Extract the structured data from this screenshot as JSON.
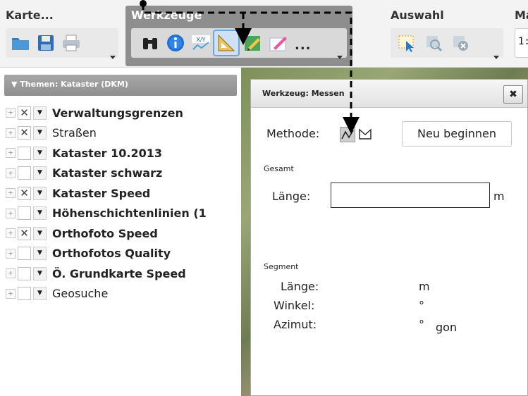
{
  "toolbar": {
    "groups": {
      "karte": {
        "title": "Karte..."
      },
      "werkzeuge": {
        "title": "Werkzeuge"
      },
      "auswahl": {
        "title": "Auswahl"
      },
      "massstab": {
        "title": "Ma",
        "scale_value": "1:"
      }
    },
    "more_label": "..."
  },
  "themes": {
    "header": "Themen: Kataster (DKM)",
    "layers": [
      {
        "label": "Verwaltungsgrenzen",
        "checked": true,
        "bold": true
      },
      {
        "label": "Straßen",
        "checked": true,
        "bold": false
      },
      {
        "label": "Kataster 10.2013",
        "checked": false,
        "bold": true
      },
      {
        "label": "Kataster schwarz",
        "checked": false,
        "bold": true
      },
      {
        "label": "Kataster Speed",
        "checked": true,
        "bold": true
      },
      {
        "label": "Höhenschichtenlinien (1",
        "checked": false,
        "bold": true
      },
      {
        "label": "Orthofoto Speed",
        "checked": true,
        "bold": true
      },
      {
        "label": "Orthofotos Quality",
        "checked": false,
        "bold": true
      },
      {
        "label": "Ö. Grundkarte Speed",
        "checked": false,
        "bold": true
      },
      {
        "label": "Geosuche",
        "checked": false,
        "bold": false
      }
    ],
    "expander_symbol": "+",
    "checked_symbol": "✕",
    "menu_symbol": "▼"
  },
  "dialog": {
    "title": "Werkzeug: Messen",
    "close_symbol": "✖",
    "method_label": "Methode:",
    "new_button": "Neu beginnen",
    "total_section": "Gesamt",
    "length_label": "Länge:",
    "length_value": "",
    "length_unit": "m",
    "segment_section": "Segment",
    "seg_length_label": "Länge:",
    "seg_length_unit": "m",
    "angle_label": "Winkel:",
    "angle_unit": "°",
    "azimuth_label": "Azimut:",
    "azimuth_unit": "°",
    "azimuth_unit2": "gon"
  }
}
